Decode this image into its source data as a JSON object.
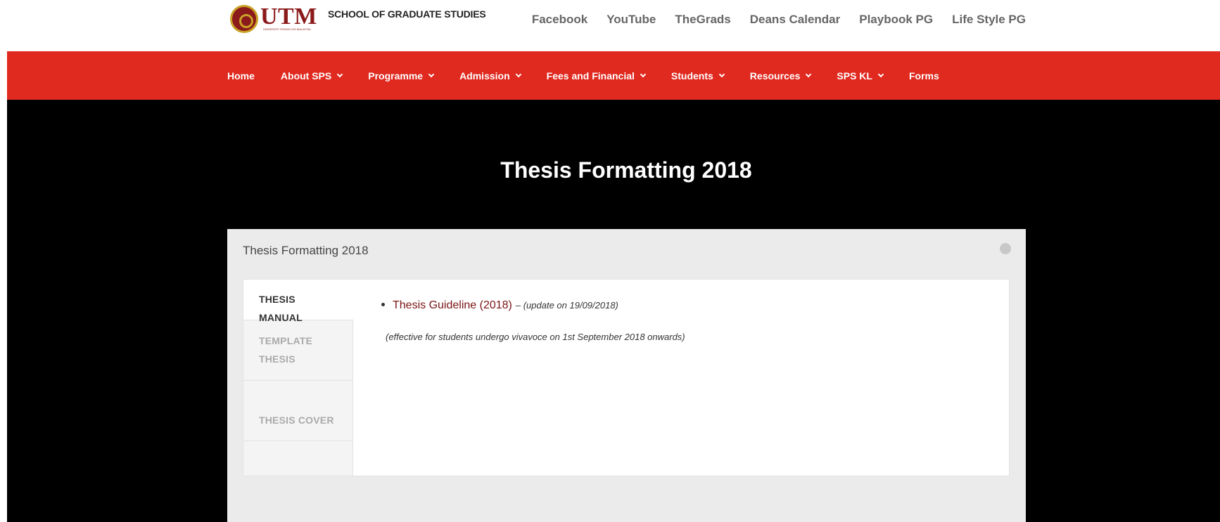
{
  "header": {
    "logo_word": "UTM",
    "logo_subtitle": "UNIVERSITI TEKNOLOGI MALAYSIA",
    "school_name": "SCHOOL OF GRADUATE STUDIES",
    "top_links": [
      "Facebook",
      "YouTube",
      "TheGrads",
      "Deans Calendar",
      "Playbook PG",
      "Life Style PG"
    ]
  },
  "nav": {
    "items": [
      {
        "label": "Home",
        "dropdown": false
      },
      {
        "label": "About SPS",
        "dropdown": true
      },
      {
        "label": "Programme",
        "dropdown": true
      },
      {
        "label": "Admission",
        "dropdown": true
      },
      {
        "label": "Fees and Financial",
        "dropdown": true
      },
      {
        "label": "Students",
        "dropdown": true
      },
      {
        "label": "Resources",
        "dropdown": true
      },
      {
        "label": "SPS KL",
        "dropdown": true
      },
      {
        "label": "Forms",
        "dropdown": false
      }
    ]
  },
  "hero": {
    "title": "Thesis Formatting 2018"
  },
  "panel": {
    "title": "Thesis Formatting 2018",
    "tabs": [
      {
        "label": "THESIS MANUAL",
        "active": true
      },
      {
        "label": "TEMPLATE THESIS",
        "active": false
      },
      {
        "label": "THESIS COVER",
        "active": false
      }
    ],
    "content": {
      "link_text": "Thesis Guideline (2018)",
      "update_text": "– (update on 19/09/2018)",
      "note": "(effective for students undergo vivavoce on 1st September 2018 onwards)"
    }
  },
  "colors": {
    "nav_bg": "#e0291f",
    "hero_bg": "#000000",
    "brand_maroon": "#8b1a1a",
    "link": "#7a1414"
  }
}
